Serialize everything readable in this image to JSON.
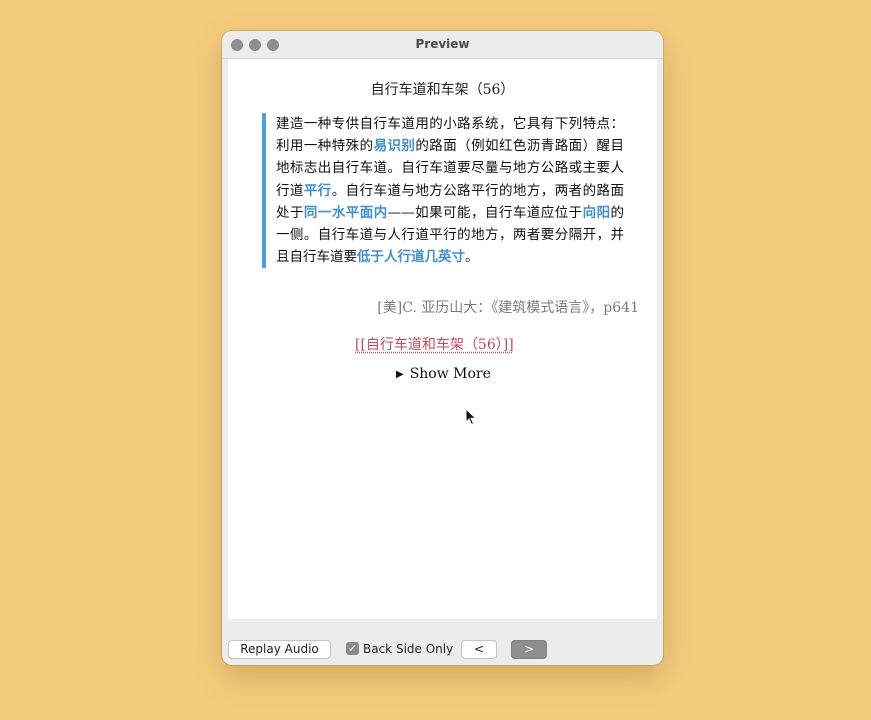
{
  "window": {
    "title": "Preview"
  },
  "card": {
    "title": "自行车道和车架（56）",
    "quote_segments": [
      {
        "text": "建造一种专供自行车道用的小路系统，它具有下列特点：利用一种特殊的",
        "highlight": false
      },
      {
        "text": "易识别",
        "highlight": true
      },
      {
        "text": "的路面（例如红色沥青路面）醒目地标志出自行车道。自行车道要尽量与地方公路或主要人行道",
        "highlight": false
      },
      {
        "text": "平行",
        "highlight": true
      },
      {
        "text": "。自行车道与地方公路平行的地方，两者的路面处于",
        "highlight": false
      },
      {
        "text": "同一水平面内",
        "highlight": true
      },
      {
        "text": "——如果可能，自行车道应位于",
        "highlight": false
      },
      {
        "text": "向阳",
        "highlight": true
      },
      {
        "text": "的一侧。自行车道与人行道平行的地方，两者要分隔开，并且自行车道要",
        "highlight": false
      },
      {
        "text": "低于人行道几英寸",
        "highlight": true
      },
      {
        "text": "。",
        "highlight": false
      }
    ],
    "source": "[美]C. 亚历山大：《建筑模式语言》，p641",
    "link": "[[自行车道和车架（56）]]",
    "show_more": "Show More",
    "show_more_icon": "disclosure-triangle-icon"
  },
  "toolbar": {
    "replay_audio": "Replay Audio",
    "back_side_only": "Back Side Only",
    "back_side_checked": true,
    "prev": "<",
    "next": ">"
  },
  "colors": {
    "background": "#f5cc7e",
    "highlight": "#3f8fd4",
    "quote_border": "#4aa0db",
    "link": "#c54a5a"
  }
}
